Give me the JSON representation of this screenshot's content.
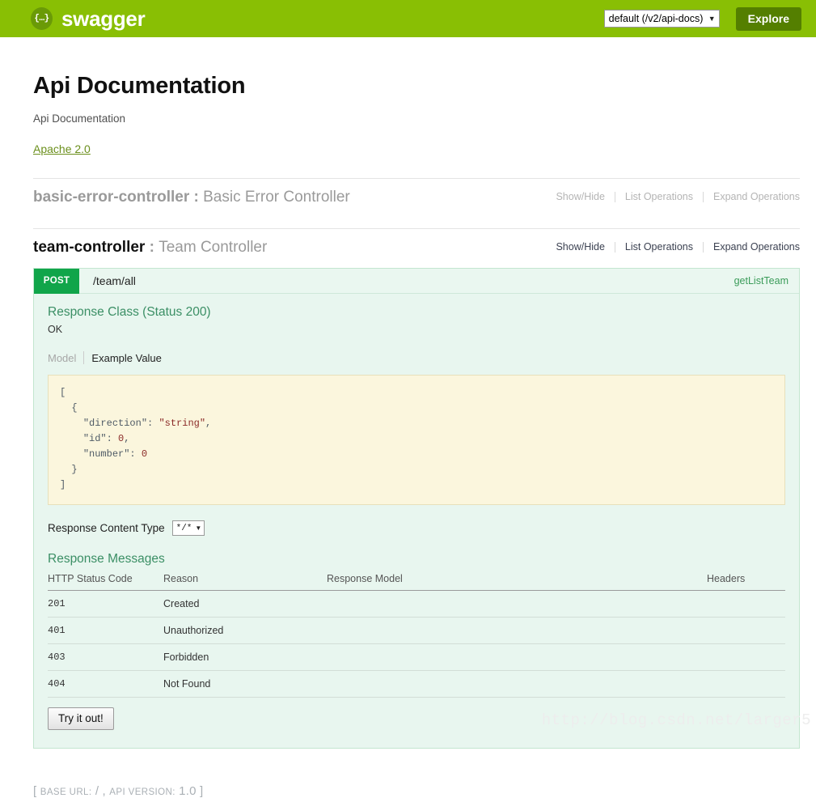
{
  "topbar": {
    "logo_glyph": "{…}",
    "brand": "swagger",
    "spec_select_value": "default (/v2/api-docs)",
    "caret": "▼",
    "explore_label": "Explore"
  },
  "info": {
    "title": "Api Documentation",
    "description": "Api Documentation",
    "license": "Apache 2.0"
  },
  "resources": [
    {
      "name": "basic-error-controller",
      "separator": " : ",
      "description": "Basic Error Controller",
      "muted": true,
      "ops_links": [
        "Show/Hide",
        "List Operations",
        "Expand Operations"
      ]
    },
    {
      "name": "team-controller",
      "separator": " : ",
      "description": "Team Controller",
      "muted": false,
      "ops_links": [
        "Show/Hide",
        "List Operations",
        "Expand Operations"
      ]
    }
  ],
  "operation": {
    "method": "POST",
    "path": "/team/all",
    "nickname": "getListTeam",
    "response_class_title": "Response Class (Status 200)",
    "response_class_desc": "OK",
    "tabs": {
      "model": "Model",
      "example": "Example Value"
    },
    "example_value": {
      "l1": "[",
      "l2": "  {",
      "l3_key": "\"direction\"",
      "l3_val": "\"string\"",
      "l4_key": "\"id\"",
      "l4_val": "0",
      "l5_key": "\"number\"",
      "l5_val": "0",
      "l6": "  }",
      "l7": "]"
    },
    "content_type_label": "Response Content Type",
    "content_type_value": "*/*",
    "content_type_caret": "▼",
    "response_messages_title": "Response Messages",
    "table": {
      "headers": [
        "HTTP Status Code",
        "Reason",
        "Response Model",
        "Headers"
      ],
      "rows": [
        {
          "code": "201",
          "reason": "Created",
          "model": "",
          "headers": ""
        },
        {
          "code": "401",
          "reason": "Unauthorized",
          "model": "",
          "headers": ""
        },
        {
          "code": "403",
          "reason": "Forbidden",
          "model": "",
          "headers": ""
        },
        {
          "code": "404",
          "reason": "Not Found",
          "model": "",
          "headers": ""
        }
      ]
    },
    "try_it_out_label": "Try it out!"
  },
  "footer": {
    "open_bracket": "[",
    "base_url_label": "BASE URL:",
    "base_url_value": "/ ,",
    "api_version_label": "API VERSION:",
    "api_version_value": "1.0",
    "close_bracket": "]"
  },
  "watermark": "http://blog.csdn.net/larger5",
  "colors": {
    "header_green": "#89bf04",
    "explore_green": "#547f00",
    "post_green": "#10a54a",
    "op_bg": "#e8f6ef",
    "example_bg": "#fbf6dd",
    "link_green": "#6b8f1c"
  }
}
